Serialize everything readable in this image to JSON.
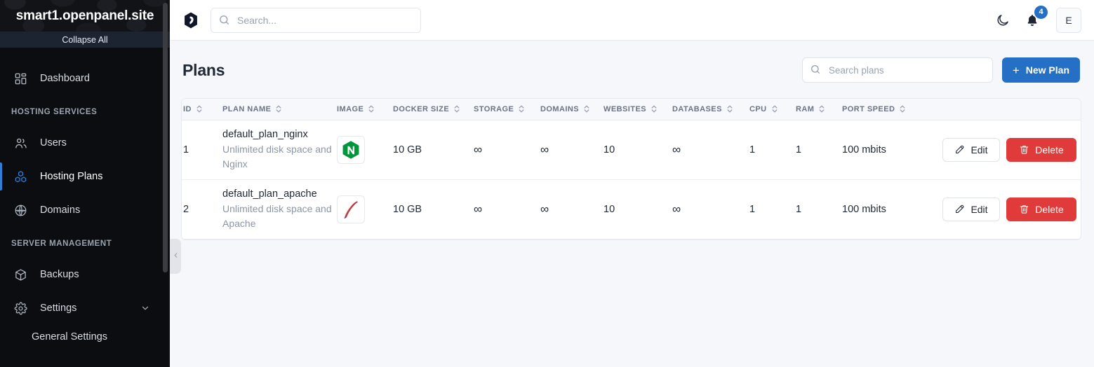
{
  "sidebar": {
    "site_title": "smart1.openpanel.site",
    "collapse_all": "Collapse All",
    "items": [
      {
        "label": "Dashboard",
        "icon": "grid-icon"
      },
      {
        "label": "Users",
        "icon": "users-icon"
      },
      {
        "label": "Hosting Plans",
        "icon": "boxes-icon"
      },
      {
        "label": "Domains",
        "icon": "globe-www-icon"
      },
      {
        "label": "Backups",
        "icon": "box-icon"
      },
      {
        "label": "Settings",
        "icon": "gear-icon"
      }
    ],
    "sections": {
      "hosting": "HOSTING SERVICES",
      "server": "SERVER MANAGEMENT"
    },
    "submenu": [
      {
        "label": "General Settings"
      }
    ],
    "active_item": "Hosting Plans"
  },
  "topbar": {
    "search_placeholder": "Search...",
    "search_value": "",
    "notification_count": "4",
    "avatar_initial": "E"
  },
  "page": {
    "title": "Plans",
    "search_placeholder": "Search plans",
    "search_value": "",
    "new_plan_label": "New Plan",
    "new_plan_plus": "+"
  },
  "table": {
    "columns": [
      "ID",
      "PLAN NAME",
      "IMAGE",
      "DOCKER SIZE",
      "STORAGE",
      "DOMAINS",
      "WEBSITES",
      "DATABASES",
      "CPU",
      "RAM",
      "PORT SPEED"
    ],
    "rows": [
      {
        "id": "1",
        "name": "default_plan_nginx",
        "desc": "Unlimited disk space and Nginx",
        "image": "nginx-logo",
        "docker_size": "10 GB",
        "storage": "∞",
        "domains": "∞",
        "websites": "10",
        "databases": "∞",
        "cpu": "1",
        "ram": "1",
        "port_speed": "100 mbits",
        "edit_label": "Edit",
        "delete_label": "Delete"
      },
      {
        "id": "2",
        "name": "default_plan_apache",
        "desc": "Unlimited disk space and Apache",
        "image": "apache-logo",
        "docker_size": "10 GB",
        "storage": "∞",
        "domains": "∞",
        "websites": "10",
        "databases": "∞",
        "cpu": "1",
        "ram": "1",
        "port_speed": "100 mbits",
        "edit_label": "Edit",
        "delete_label": "Delete"
      }
    ]
  },
  "colors": {
    "accent_blue": "#2570c4",
    "danger_red": "#e03a3a",
    "sidebar_bg": "#0c0d10",
    "nginx_green": "#009639",
    "apache_orange": "#f6931e"
  }
}
